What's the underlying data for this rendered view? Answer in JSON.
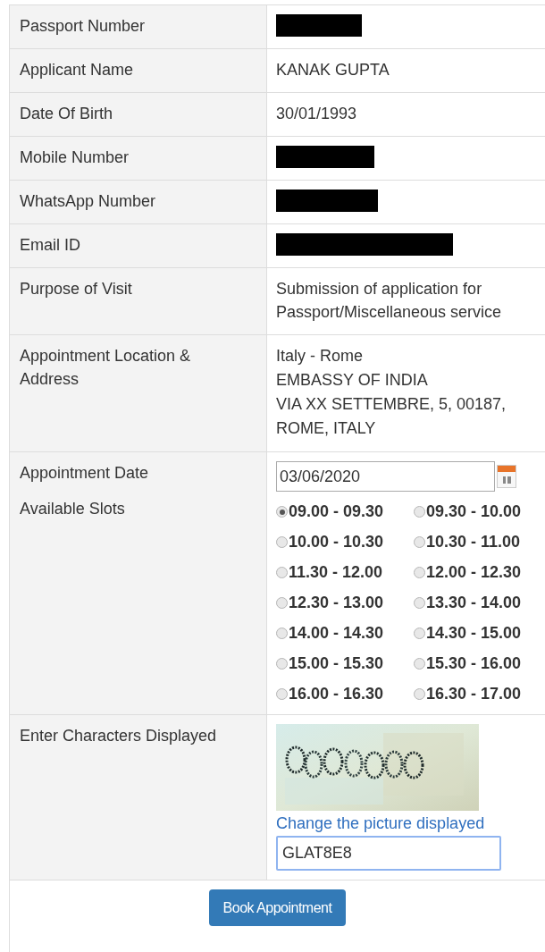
{
  "details": [
    {
      "label": "Passport Number",
      "kind": "redacted"
    },
    {
      "label": "Applicant Name",
      "kind": "text",
      "value": "KANAK GUPTA"
    },
    {
      "label": "Date Of Birth",
      "kind": "text",
      "value": "30/01/1993"
    },
    {
      "label": "Mobile Number",
      "kind": "redacted"
    },
    {
      "label": "WhatsApp Number",
      "kind": "redacted"
    },
    {
      "label": "Email ID",
      "kind": "redacted"
    },
    {
      "label": "Purpose of Visit",
      "kind": "text",
      "value": "Submission of application for Passport/Miscellaneous service"
    },
    {
      "label": "Appointment Location & Address",
      "kind": "lines",
      "lines": [
        "Italy - Rome",
        "EMBASSY OF INDIA",
        "VIA XX SETTEMBRE, 5, 00187,",
        "ROME, ITALY"
      ]
    }
  ],
  "date": {
    "label": "Appointment Date",
    "value": "03/06/2020"
  },
  "slots": {
    "label": "Available Slots",
    "items": [
      {
        "label": "09.00 - 09.30",
        "selected": true
      },
      {
        "label": "09.30 - 10.00",
        "selected": false
      },
      {
        "label": "10.00 - 10.30",
        "selected": false
      },
      {
        "label": "10.30 - 11.00",
        "selected": false
      },
      {
        "label": "11.30 - 12.00",
        "selected": false
      },
      {
        "label": "12.00 - 12.30",
        "selected": false
      },
      {
        "label": "12.30 - 13.00",
        "selected": false
      },
      {
        "label": "13.30 - 14.00",
        "selected": false
      },
      {
        "label": "14.00 - 14.30",
        "selected": false
      },
      {
        "label": "14.30 - 15.00",
        "selected": false
      },
      {
        "label": "15.00 - 15.30",
        "selected": false
      },
      {
        "label": "15.30 - 16.00",
        "selected": false
      },
      {
        "label": "16.00 - 16.30",
        "selected": false
      },
      {
        "label": "16.30 - 17.00",
        "selected": false
      }
    ]
  },
  "captcha": {
    "label": "Enter Characters Displayed",
    "change_link": "Change the picture displayed",
    "value": "GLAT8E8"
  },
  "submit": "Book Appointment"
}
